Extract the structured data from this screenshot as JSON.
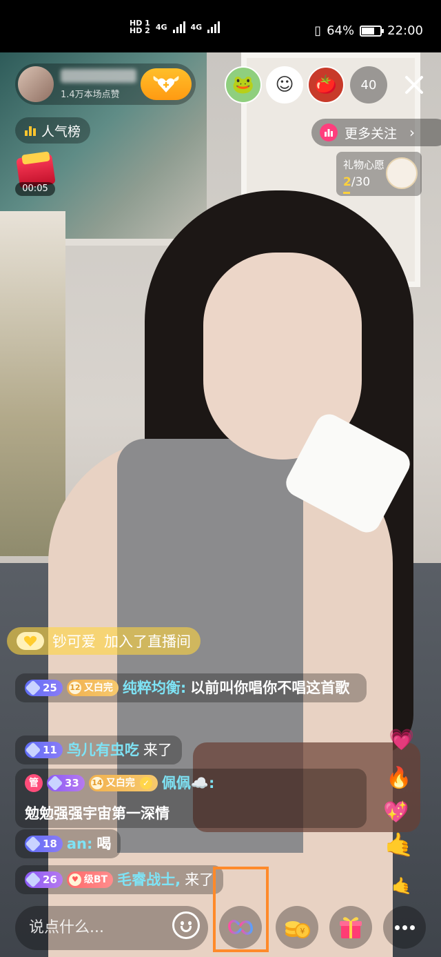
{
  "status_bar": {
    "hd1": "HD 1",
    "hd2": "HD 2",
    "net1": "4G",
    "net2": "4G",
    "battery": "64%",
    "time": "22:00"
  },
  "anchor": {
    "likes": "1.4万本场点赞"
  },
  "viewers": {
    "count": "40"
  },
  "rank": {
    "label": "人气榜"
  },
  "more_follow": {
    "label": "更多关注"
  },
  "red_packet": {
    "timer": "00:05"
  },
  "gift_wish": {
    "title": "礼物心愿",
    "current": "2",
    "total": "/30"
  },
  "join": {
    "user": "钞可爱",
    "text": "加入了直播间"
  },
  "chat": [
    {
      "level": "25",
      "fan_level": "12",
      "fan_club": "又白完",
      "user": "纯粹均衡:",
      "message": "以前叫你唱你不唱这首歌"
    },
    {
      "level": "11",
      "user": "鸟儿有虫吃",
      "message": "来了"
    },
    {
      "admin": "管",
      "level": "33",
      "fan_level": "14",
      "fan_club": "又白完",
      "user": "佩佩☁️:",
      "message": "勉勉强强宇宙第一深情"
    },
    {
      "level": "18",
      "user": "an:",
      "message": "喝"
    },
    {
      "level": "26",
      "fan_club": "级BT",
      "user": "毛睿战士,",
      "message": "来了"
    }
  ],
  "bottom": {
    "input_placeholder": "说点什么..."
  },
  "colors": {
    "accent_orange": "#ff8a2a",
    "username_cyan": "#7ee3f5",
    "gold": "#ffd23a"
  }
}
